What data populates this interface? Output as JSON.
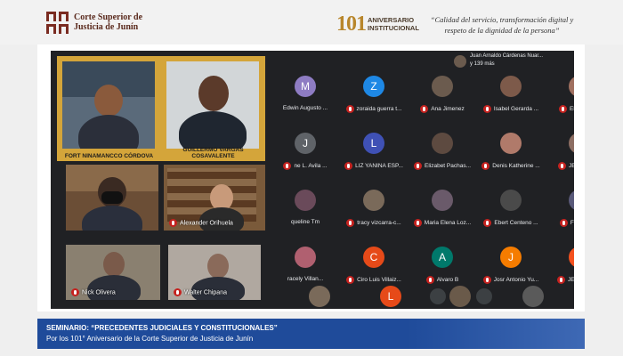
{
  "header": {
    "org_line1": "Corte Superior de",
    "org_line2": "Justicia de Junín",
    "anniversary_number": "101",
    "anniversary_line1": "ANIVERSARIO",
    "anniversary_line2": "INSTITUCIONAL",
    "quote_line1": "“Calidad del servicio, transformación digital y",
    "quote_line2": "respeto de la dignidad de la persona”"
  },
  "speakers": [
    {
      "name": "FORT NINAMANCCO CÓRDOVA"
    },
    {
      "name": "GUILLERMO VARGAS COSAVALENTE"
    }
  ],
  "video_tiles": [
    {
      "name": ""
    },
    {
      "name": "Alexander Orihuela"
    },
    {
      "name": "Nick Olivera"
    },
    {
      "name": "Walter Chipana"
    }
  ],
  "participants_top": {
    "line1": "Juan Arnaldo Cárdenas Nuar...",
    "line2": "y 139 más"
  },
  "participants": [
    {
      "initial": "M",
      "name": "Edwin Augusto ...",
      "color": "#8e7cc3",
      "muted": false
    },
    {
      "initial": "Z",
      "name": "zoraida guerra t...",
      "color": "#1e88e5",
      "muted": true
    },
    {
      "initial": "",
      "name": "Ana Jimenez",
      "color": "#6b5b4e",
      "muted": true
    },
    {
      "initial": "",
      "name": "Isabel Gerarda ...",
      "color": "#7d5a4a",
      "muted": true
    },
    {
      "initial": "",
      "name": "Elizabeth ...",
      "color": "#a07060",
      "muted": true
    },
    {
      "initial": "J",
      "name": "ne L. Avila ...",
      "color": "#5f6368",
      "muted": true
    },
    {
      "initial": "L",
      "name": "LIZ YANINA ESP...",
      "color": "#3f51b5",
      "muted": true
    },
    {
      "initial": "",
      "name": "Elizabet Pachas...",
      "color": "#5d4a40",
      "muted": true
    },
    {
      "initial": "",
      "name": "Denis Katherine ...",
      "color": "#b07a6a",
      "muted": true
    },
    {
      "initial": "J",
      "name": "JENIS AID...",
      "color": "#8d6e63",
      "muted": true
    },
    {
      "initial": "",
      "name": "queline Tm",
      "color": "#6a4a5a",
      "muted": false
    },
    {
      "initial": "",
      "name": "tracy vizcarra-c...",
      "color": "#7a6a5a",
      "muted": true
    },
    {
      "initial": "",
      "name": "Maria Elena Loz...",
      "color": "#6a5a6a",
      "muted": true
    },
    {
      "initial": "",
      "name": "Ebert Centeno ...",
      "color": "#4a4a4a",
      "muted": true
    },
    {
      "initial": "",
      "name": "Fiorela Li...",
      "color": "#5a5a7a",
      "muted": true
    },
    {
      "initial": "",
      "name": "racely Villan...",
      "color": "#b06070",
      "muted": false
    },
    {
      "initial": "C",
      "name": "Ciro Luis Villaiz...",
      "color": "#e64a19",
      "muted": true
    },
    {
      "initial": "A",
      "name": "Alvaro B",
      "color": "#00796b",
      "muted": true
    },
    {
      "initial": "J",
      "name": "Josr Antonio Yu...",
      "color": "#f57c00",
      "muted": true
    },
    {
      "initial": "J",
      "name": "JESÚS RO...",
      "color": "#f4511e",
      "muted": true
    }
  ],
  "bottom_row": [
    {
      "initial": "",
      "color": "#7a6a5a"
    },
    {
      "initial": "L",
      "color": "#e64a19"
    },
    {
      "initial": "",
      "color": "#6a5a4a"
    },
    {
      "initial": "",
      "color": "#5a5a5a"
    }
  ],
  "banner": {
    "line1": "SEMINARIO: “PRECEDENTES JUDICIALES Y CONSTITUCIONALES”",
    "line2": "Por los 101° Aniversario de la Corte Superior de Justicia de Junín"
  },
  "colors": {
    "brand": "#5a2a1d",
    "gold": "#d4a53a",
    "banner": "#1f4b9a",
    "meet_bg": "#202124",
    "muted_red": "#c5221f"
  }
}
